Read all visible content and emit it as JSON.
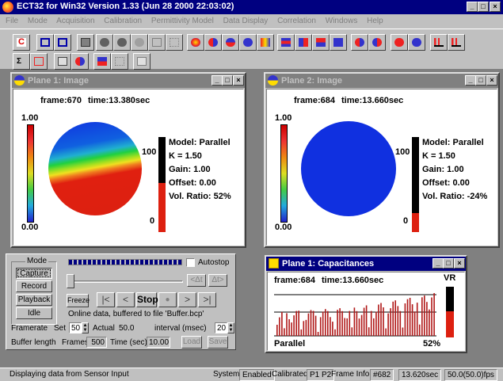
{
  "app": {
    "title": "ECT32 for Win32 Version 1.33 (Jun 28 2000 22:03:02)"
  },
  "menu": [
    "File",
    "Mode",
    "Acquisition",
    "Calibration",
    "Permittivity Model",
    "Data Display",
    "Correlation",
    "Windows",
    "Help"
  ],
  "plane1": {
    "title": "Plane 1: Image",
    "frame": "frame:670",
    "time": "time:13.380sec",
    "scale_top": "1.00",
    "scale_bottom": "0.00",
    "bar_top": "100",
    "bar_bottom": "0",
    "model": "Model: Parallel",
    "k": "K = 1.50",
    "gain": "Gain: 1.00",
    "offset": "Offset: 0.00",
    "vol_ratio": "Vol. Ratio: 52%",
    "bar_fill_fraction": 0.52
  },
  "plane2": {
    "title": "Plane 2: Image",
    "frame": "frame:684",
    "time": "time:13.660sec",
    "scale_top": "1.00",
    "scale_bottom": "0.00",
    "bar_top": "100",
    "bar_bottom": "0",
    "model": "Model: Parallel",
    "k": "K = 1.50",
    "gain": "Gain: 1.00",
    "offset": "Offset: 0.00",
    "vol_ratio": "Vol. Ratio: -24%",
    "bar_fill_fraction": 0.2
  },
  "capacitances": {
    "title": "Plane 1: Capacitances",
    "frame": "frame:684",
    "time": "time:13.660sec",
    "vr_label": "VR",
    "model": "Parallel",
    "percent": "52%",
    "bar_fill_fraction": 0.52
  },
  "control": {
    "mode_label": "Mode",
    "buttons": [
      "Capture",
      "Record",
      "Playback",
      "Idle"
    ],
    "autostop": "Autostop",
    "delta_buttons": [
      "<Δt",
      "Δt>"
    ],
    "freeze": "Freeze",
    "nav": [
      "|<",
      "<",
      "Stop",
      "●",
      ">",
      ">|"
    ],
    "info": "Online data, buffered to file 'Buffer.bcp'",
    "framerate_label": "Framerate",
    "set_label": "Set",
    "set_value": "50",
    "actual_label": "Actual",
    "actual_value": "50.0",
    "interval_label": "interval (msec)",
    "interval_value": "20",
    "buffer_label": "Buffer length",
    "frames_label": "Frames",
    "frames_value": "500",
    "time_label": "Time (sec)",
    "time_value": "10.00",
    "load": "Load",
    "save": "Save"
  },
  "statusbar": {
    "message": "Displaying data from Sensor Input",
    "system_label": "System:",
    "system_value": "Enabled",
    "calibrated_label": "Calibrated:",
    "calibrated_value": "P1 P2",
    "frame_info_label": "Frame Info:",
    "frame_info_value": "#682",
    "time_value": "13.620sec",
    "fps_value": "50.0(50.0)fps"
  },
  "colors": {
    "titlebar": "#000080",
    "face": "#c0c0c0",
    "desktop": "#808080",
    "red": "#dd2010",
    "blue": "#1030e0"
  }
}
